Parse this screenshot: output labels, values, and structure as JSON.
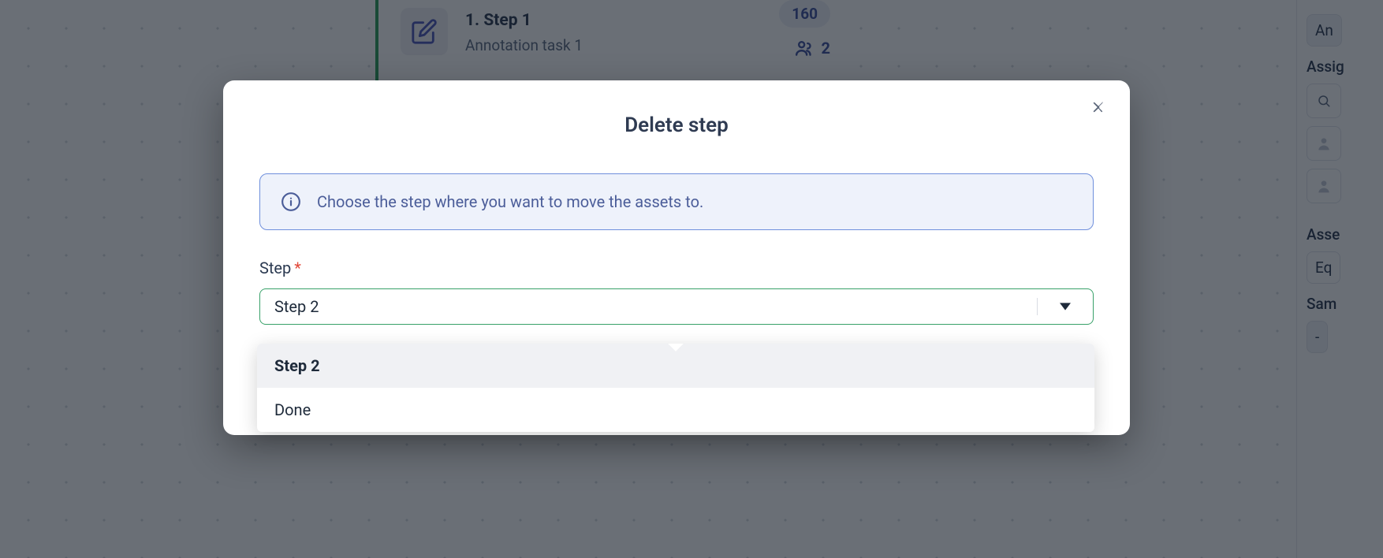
{
  "step_card": {
    "title": "1. Step 1",
    "subtitle": "Annotation task 1",
    "count": "160",
    "workers": "2"
  },
  "right_panel": {
    "btn1": "An",
    "label_assignee": "Assig",
    "label_assets": "Asse",
    "eq": "Eq",
    "label_sampling": "Sam",
    "dash": "-"
  },
  "modal": {
    "title": "Delete step",
    "info": "Choose the step where you want to move the assets to.",
    "field_label": "Step",
    "selected_value": "Step 2",
    "options": [
      "Step 2",
      "Done"
    ]
  }
}
